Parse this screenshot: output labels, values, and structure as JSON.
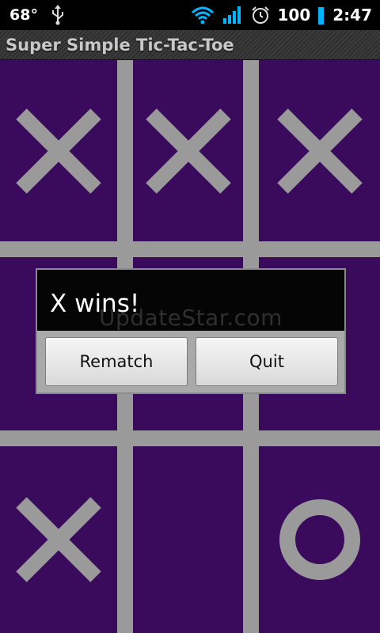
{
  "status_bar": {
    "temperature": "68°",
    "battery": "100",
    "time": "2:47",
    "icons": [
      "usb-icon",
      "wifi-icon",
      "signal-icon",
      "alarm-icon",
      "battery-icon"
    ]
  },
  "app": {
    "title": "Super Simple Tic-Tac-Toe"
  },
  "board": {
    "cells": [
      "X",
      "X",
      "X",
      "",
      "",
      "",
      "X",
      "",
      "O"
    ]
  },
  "dialog": {
    "message": "X wins!",
    "watermark": "UpdateStar.com",
    "buttons": {
      "rematch": "Rematch",
      "quit": "Quit"
    }
  },
  "colors": {
    "board_bg": "#3a0b5c",
    "mark": "#9a9a9a",
    "accent": "#00b4ff"
  }
}
